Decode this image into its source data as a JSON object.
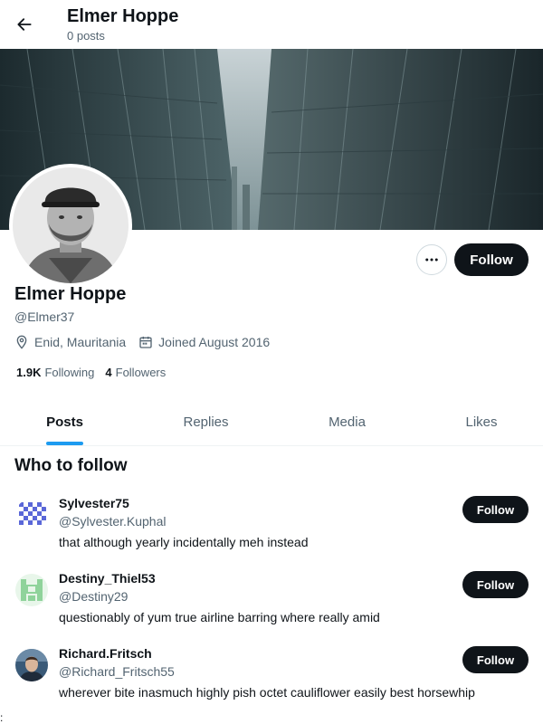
{
  "header": {
    "title": "Elmer Hoppe",
    "post_count": "0 posts"
  },
  "profile": {
    "name": "Elmer Hoppe",
    "handle": "@Elmer37",
    "location": "Enid, Mauritania",
    "joined": "Joined August 2016",
    "following_count": "1.9K",
    "following_label": "Following",
    "followers_count": "4",
    "followers_label": "Followers",
    "follow_label": "Follow"
  },
  "tabs": [
    {
      "label": "Posts",
      "active": true
    },
    {
      "label": "Replies",
      "active": false
    },
    {
      "label": "Media",
      "active": false
    },
    {
      "label": "Likes",
      "active": false
    }
  ],
  "who_to_follow": {
    "title": "Who to follow",
    "items": [
      {
        "name": "Sylvester75",
        "handle": "@Sylvester.Kuphal",
        "bio": "that although yearly incidentally meh instead",
        "follow_label": "Follow"
      },
      {
        "name": "Destiny_Thiel53",
        "handle": "@Destiny29",
        "bio": "questionably of yum true airline barring where really amid",
        "follow_label": "Follow"
      },
      {
        "name": "Richard.Fritsch",
        "handle": "@Richard_Fritsch55",
        "bio": "wherever bite inasmuch highly pish octet cauliflower easily best horsewhip",
        "follow_label": "Follow"
      }
    ]
  },
  "edge_mark": ":",
  "colors": {
    "accent": "#1d9bf0",
    "button_dark": "#0f1419",
    "muted_text": "#536471"
  },
  "icons": [
    "back-arrow-icon",
    "more-options-icon",
    "location-pin-icon",
    "calendar-icon"
  ]
}
